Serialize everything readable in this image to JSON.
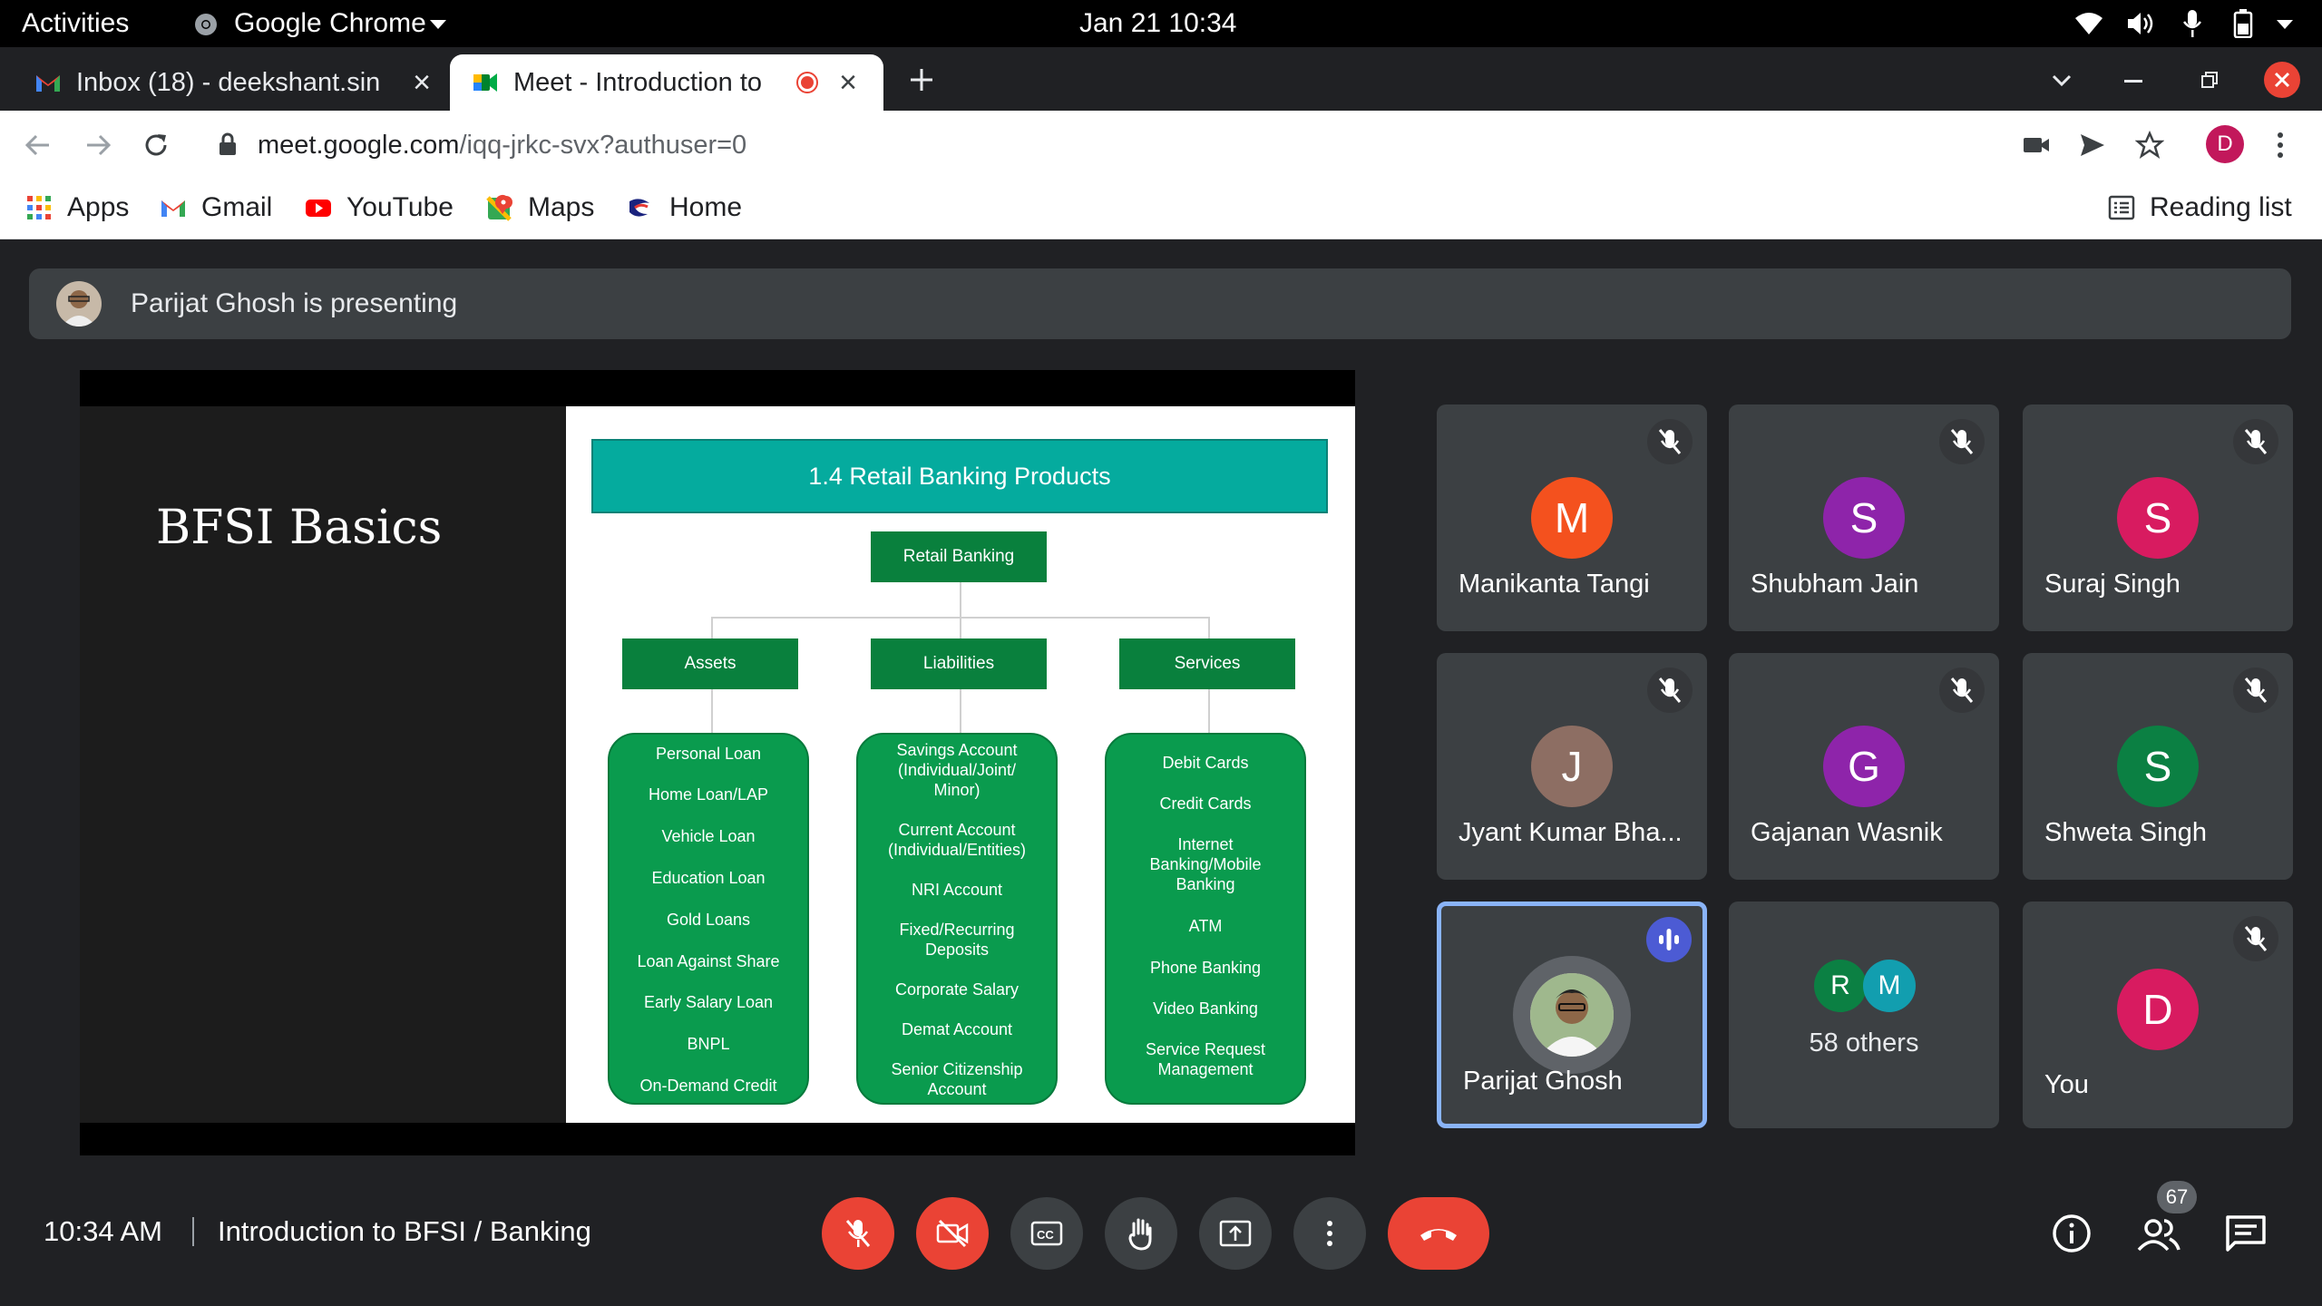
{
  "system": {
    "activities": "Activities",
    "app_name": "Google Chrome",
    "datetime": "Jan 21  10:34"
  },
  "tabs": [
    {
      "title": "Inbox (18) - deekshant.sin",
      "favicon": "gmail-icon"
    },
    {
      "title": "Meet - Introduction to",
      "favicon": "meet-icon",
      "recording": true
    }
  ],
  "omnibox": {
    "host": "meet.google.com",
    "path": "/iqq-jrkc-svx?authuser=0"
  },
  "profile_initial": "D",
  "bookmarks": [
    {
      "label": "Apps",
      "icon": "apps-grid-icon"
    },
    {
      "label": "Gmail",
      "icon": "gmail-icon"
    },
    {
      "label": "YouTube",
      "icon": "youtube-icon"
    },
    {
      "label": "Maps",
      "icon": "maps-icon"
    },
    {
      "label": "Home",
      "icon": "home-icon"
    }
  ],
  "reading_list": "Reading list",
  "presenting_banner": "Parijat Ghosh is presenting",
  "slide": {
    "left_title": "BFSI Basics",
    "header": "1.4 Retail Banking Products",
    "root": "Retail Banking",
    "categories": [
      "Assets",
      "Liabilities",
      "Services"
    ],
    "assets": [
      "Personal Loan",
      "Home Loan/LAP",
      "Vehicle Loan",
      "Education Loan",
      "Gold Loans",
      "Loan Against Share",
      "Early Salary Loan",
      "BNPL",
      "On-Demand Credit"
    ],
    "liabilities": [
      "Savings Account (Individual/Joint/ Minor)",
      "Current Account (Individual/Entities)",
      "NRI Account",
      "Fixed/Recurring Deposits",
      "Corporate Salary",
      "Demat Account",
      "Senior Citizenship Account"
    ],
    "services": [
      "Debit Cards",
      "Credit Cards",
      "Internet Banking/Mobile Banking",
      "ATM",
      "Phone Banking",
      "Video Banking",
      "Service Request Management"
    ]
  },
  "participants": [
    {
      "name": "Manikanta Tangi",
      "initial": "M",
      "color": "#f4511e",
      "muted": true
    },
    {
      "name": "Shubham Jain",
      "initial": "S",
      "color": "#8e24aa",
      "muted": true
    },
    {
      "name": "Suraj Singh",
      "initial": "S",
      "color": "#d81b60",
      "muted": true
    },
    {
      "name": "Jyant Kumar Bha...",
      "initial": "J",
      "color": "#8d6e63",
      "muted": true
    },
    {
      "name": "Gajanan Wasnik",
      "initial": "G",
      "color": "#8e24aa",
      "muted": true
    },
    {
      "name": "Shweta Singh",
      "initial": "S",
      "color": "#0b8043",
      "muted": true
    },
    {
      "name": "Parijat Ghosh",
      "speaking": true
    },
    {
      "others_label": "58 others",
      "avatars": [
        {
          "initial": "R",
          "color": "#0b8043"
        },
        {
          "initial": "M",
          "color": "#129eaf"
        }
      ]
    },
    {
      "name": "You",
      "initial": "D",
      "color": "#d81b60",
      "muted": true
    }
  ],
  "bottom": {
    "time": "10:34 AM",
    "meeting_name": "Introduction to BFSI / Banking",
    "participants_count": "67"
  }
}
